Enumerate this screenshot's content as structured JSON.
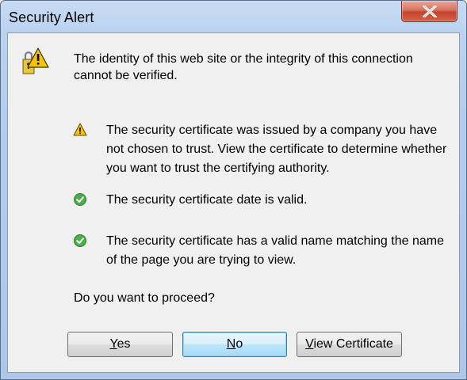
{
  "window": {
    "title": "Security Alert"
  },
  "message": {
    "intro": "The identity of this web site or the integrity of this connection cannot be verified.",
    "items": [
      {
        "icon": "warning-icon",
        "text": "The security certificate was issued by a company you have not chosen to trust. View the certificate to determine whether you want to trust the certifying authority."
      },
      {
        "icon": "check-icon",
        "text": "The security certificate date is valid."
      },
      {
        "icon": "check-icon",
        "text": "The security certificate has a valid name matching the name of the page you are trying to view."
      }
    ],
    "question": "Do you want to proceed?"
  },
  "buttons": {
    "yes": {
      "first": "Y",
      "rest": "es"
    },
    "no": {
      "first": "N",
      "rest": "o"
    },
    "view": {
      "first": "V",
      "rest": "iew Certificate"
    }
  },
  "colors": {
    "client_bg": "#f0f0f0",
    "close_red": "#c7432e",
    "warning_yellow": "#f5c400",
    "check_green": "#3a9a3a",
    "default_button_blue": "#3c7fb1"
  }
}
